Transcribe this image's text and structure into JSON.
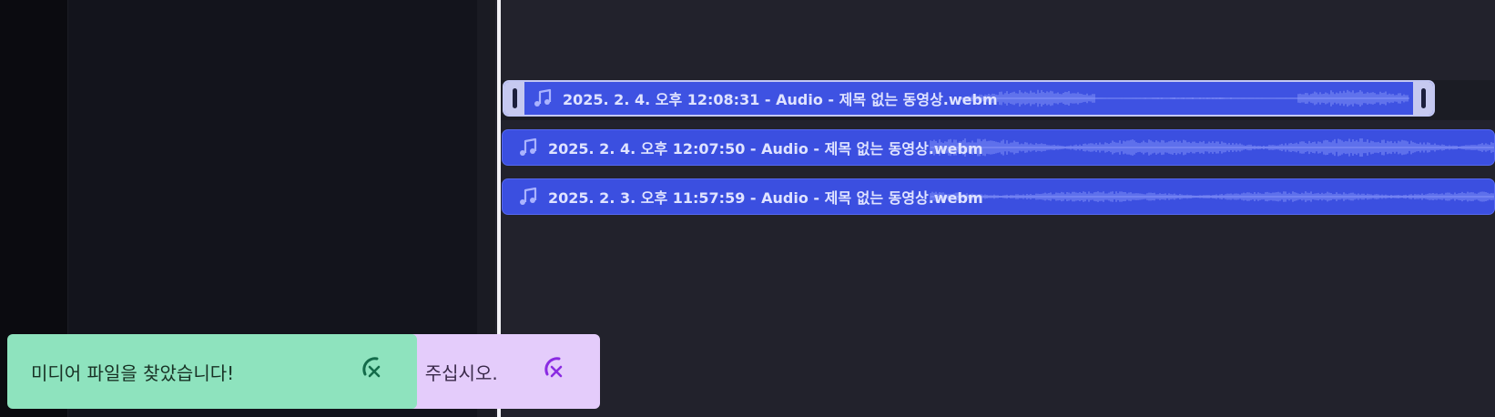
{
  "colors": {
    "clip": "#3b4fe0",
    "clip_selected_border": "#c3c7f3",
    "waveform": "#9aa6ff",
    "toast_success": "#8ee3be",
    "toast_info": "#e4ccfb",
    "playhead": "#f2f2f6"
  },
  "clips": [
    {
      "label": "2025. 2. 4. 오후 12:08:31 - Audio - 제목 없는 동영상.webm",
      "icon": "music-note-icon",
      "selected": true
    },
    {
      "label": "2025. 2. 4. 오후 12:07:50 - Audio - 제목 없는 동영상.webm",
      "icon": "music-note-icon",
      "selected": false
    },
    {
      "label": "2025. 2. 3. 오후 11:57:59 - Audio - 제목 없는 동영상.webm",
      "icon": "music-note-icon",
      "selected": false
    }
  ],
  "notifications": {
    "success": {
      "message": "미디어 파일을 찾았습니다!",
      "close_icon": "close-icon"
    },
    "info": {
      "message": "려 주십시오.",
      "close_icon": "close-icon"
    }
  }
}
